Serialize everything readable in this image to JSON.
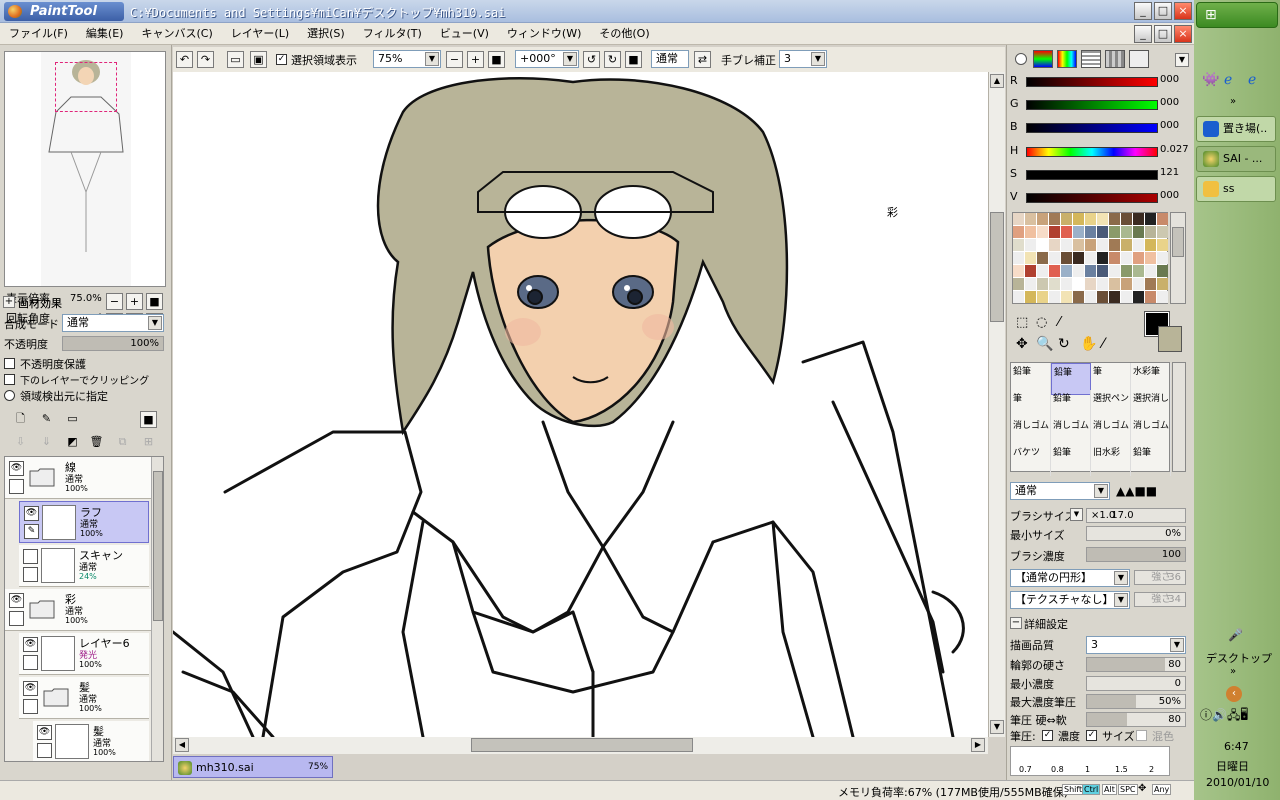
{
  "window": {
    "app_name": "PaintTool SAI",
    "title_path": "C:¥Documents and Settings¥miCan¥デスクトップ¥mh310.sai",
    "min": "_",
    "max": "□",
    "close": "×"
  },
  "menu": [
    "ファイル(F)",
    "編集(E)",
    "キャンバス(C)",
    "レイヤー(L)",
    "選択(S)",
    "フィルタ(T)",
    "ビュー(V)",
    "ウィンドウ(W)",
    "その他(O)"
  ],
  "toolbar": {
    "show_selection_label": "選択領域表示",
    "zoom_value": "75%",
    "rotate_value": "+000°",
    "blend_mode": "通常",
    "stabilizer_label": "手ブレ補正",
    "stabilizer_value": "3"
  },
  "navigator": {
    "zoom_label": "表示倍率",
    "zoom_value": "75.0%",
    "rotate_label": "回転角度",
    "rotate_value": "+000°"
  },
  "layer_props": {
    "effects_label": "画材効果",
    "blend_label": "合成モード",
    "blend_value": "通常",
    "opacity_label": "不透明度",
    "opacity_value": "100%",
    "opacity_fraction": 1.0,
    "protect_opacity": "不透明度保護",
    "clip_lower": "下のレイヤーでクリッピング",
    "selection_source": "領域検出元に指定"
  },
  "layers": [
    {
      "name": "線",
      "mode": "通常",
      "opacity": "100%",
      "type": "folder"
    },
    {
      "name": "ラフ",
      "mode": "通常",
      "opacity": "100%",
      "type": "layer",
      "selected": true
    },
    {
      "name": "スキャン",
      "mode": "通常",
      "opacity": "24%",
      "type": "layer"
    },
    {
      "name": "彩",
      "mode": "通常",
      "opacity": "100%",
      "type": "folder"
    },
    {
      "name": "レイヤー6",
      "mode": "発光",
      "opacity": "100%",
      "type": "layer"
    },
    {
      "name": "髪",
      "mode": "通常",
      "opacity": "100%",
      "type": "folder"
    },
    {
      "name": "髪",
      "mode": "通常",
      "opacity": "100%",
      "type": "layer"
    }
  ],
  "canvas_tab": {
    "name": "mh310.sai",
    "zoom": "75%"
  },
  "color": {
    "R": "000",
    "G": "000",
    "B": "000",
    "H": "0.027",
    "S": "121",
    "V": "000",
    "foreground": "#000000",
    "background": "#b8b498"
  },
  "brushes": [
    [
      "鉛筆",
      "鉛筆",
      "筆",
      "水彩筆"
    ],
    [
      "筆",
      "鉛筆",
      "選択ペン",
      "選択消し"
    ],
    [
      "消しゴム",
      "消しゴム",
      "消しゴム",
      "消しゴム"
    ],
    [
      "バケツ",
      "鉛筆",
      "旧水彩",
      "鉛筆"
    ]
  ],
  "brush_settings": {
    "mode": "通常",
    "size_label": "ブラシサイズ",
    "size_mult": "×1.0",
    "size_value": "17.0",
    "min_size_label": "最小サイズ",
    "min_size_value": "0%",
    "density_label": "ブラシ濃度",
    "density_value": "100",
    "shape": "【通常の円形】",
    "shape_strength": "強さ",
    "shape_strength_value": "36",
    "texture": "【テクスチャなし】",
    "texture_strength": "強さ",
    "texture_strength_value": "34",
    "detail_label": "詳細設定",
    "quality_label": "描画品質",
    "quality_value": "3",
    "edge_label": "輪郭の硬さ",
    "edge_value": "80",
    "min_density_label": "最小濃度",
    "min_density_value": "0",
    "max_pressure_label": "最大濃度筆圧",
    "max_pressure_value": "50%",
    "pressure_label": "筆圧 硬⇔軟",
    "pressure_value": "80",
    "pressure_opts_label": "筆圧:",
    "density_chk": "濃度",
    "size_chk": "サイズ",
    "blend_chk": "混色",
    "scale": [
      "0.7",
      "0.8",
      "1",
      "1.5",
      "2"
    ]
  },
  "canvas_note": "彩",
  "status": {
    "memory": "メモリ負荷率:67% (177MB使用/555MB確保)",
    "keys": [
      "Shift",
      "Ctrl",
      "Alt",
      "SPC",
      "Any"
    ]
  },
  "taskbar": {
    "quick_label": "置き場(..",
    "sai_label": "SAI - ...",
    "ss_label": "ss",
    "desktop_label": "デスクトップ",
    "time": "6:47",
    "weekday": "日曜日",
    "date": "2010/01/10"
  }
}
